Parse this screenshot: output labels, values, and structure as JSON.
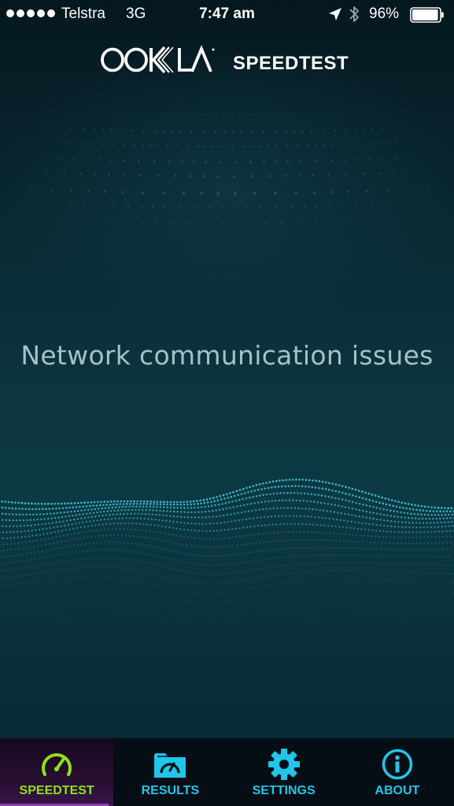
{
  "status_bar": {
    "signal_bars": 5,
    "carrier": "Telstra",
    "network_type": "3G",
    "time": "7:47 am",
    "battery_percent": "96%",
    "battery_level": 0.96,
    "icons": [
      "location-arrow-icon",
      "bluetooth-icon",
      "battery-icon"
    ]
  },
  "header": {
    "logo_text": "OOKLA",
    "title": "SPEEDTEST"
  },
  "main": {
    "message": "Network communication issues"
  },
  "tab_bar": {
    "active_tab": "speedtest",
    "tabs": [
      {
        "id": "speedtest",
        "label": "SPEEDTEST",
        "icon": "speedometer-icon"
      },
      {
        "id": "results",
        "label": "RESULTS",
        "icon": "results-folder-icon"
      },
      {
        "id": "settings",
        "label": "SETTINGS",
        "icon": "gear-icon"
      },
      {
        "id": "about",
        "label": "ABOUT",
        "icon": "info-icon"
      }
    ]
  },
  "colors": {
    "background": "#0a2e38",
    "tab_bar_background": "#040e14",
    "tab_active_label": "#8fe21a",
    "tab_inactive": "#1fc6ea",
    "active_tab_highlight": "#2a0f34",
    "message_text": "#a9c0c5",
    "wave_dots": "#3fd6e6"
  }
}
